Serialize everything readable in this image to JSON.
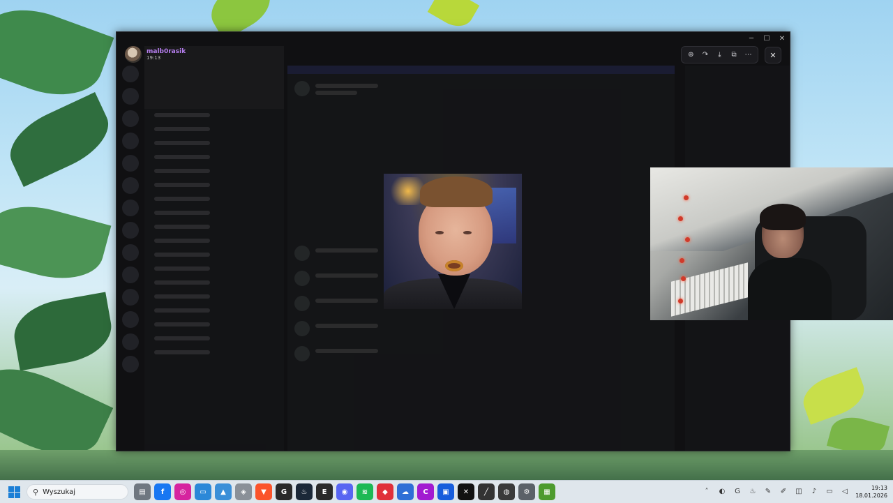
{
  "viewer": {
    "uploader_name": "malb0rasik",
    "upload_time": "19:13"
  },
  "taskbar": {
    "search_placeholder": "Wyszukaj",
    "time": "19:13",
    "date": "18.01.2026",
    "apps": [
      {
        "name": "file-explorer-icon",
        "glyph": "▤",
        "color": "#6f7780"
      },
      {
        "name": "facebook-icon",
        "glyph": "f",
        "color": "#1877f2"
      },
      {
        "name": "instagram-icon",
        "glyph": "◎",
        "color": "#d6249f"
      },
      {
        "name": "monitor-icon",
        "glyph": "▭",
        "color": "#2b88d8"
      },
      {
        "name": "photos-icon",
        "glyph": "▲",
        "color": "#3a8fd8"
      },
      {
        "name": "shield-icon",
        "glyph": "◈",
        "color": "#8a9098"
      },
      {
        "name": "brave-icon",
        "glyph": "▼",
        "color": "#fb542b"
      },
      {
        "name": "g-app-icon",
        "glyph": "G",
        "color": "#2a2a2a"
      },
      {
        "name": "steam-icon",
        "glyph": "♨",
        "color": "#1b2838"
      },
      {
        "name": "epic-games-icon",
        "glyph": "E",
        "color": "#2a2a2a"
      },
      {
        "name": "discord-icon",
        "glyph": "◉",
        "color": "#5865f2"
      },
      {
        "name": "spotify-icon",
        "glyph": "≋",
        "color": "#1db954"
      },
      {
        "name": "red-app-icon",
        "glyph": "◆",
        "color": "#e0303a"
      },
      {
        "name": "cloud-app-icon",
        "glyph": "☁",
        "color": "#2f6fd6"
      },
      {
        "name": "c-app-icon",
        "glyph": "C",
        "color": "#a21bd1"
      },
      {
        "name": "bitwarden-icon",
        "glyph": "▣",
        "color": "#175ddc"
      },
      {
        "name": "capcut-icon",
        "glyph": "✕",
        "color": "#111111"
      },
      {
        "name": "notepad-icon",
        "glyph": "╱",
        "color": "#333333"
      },
      {
        "name": "obs-icon",
        "glyph": "◍",
        "color": "#3a3a3a"
      },
      {
        "name": "settings-icon",
        "glyph": "⚙",
        "color": "#5b6168"
      },
      {
        "name": "minecraft-icon",
        "glyph": "▦",
        "color": "#4e9b2e"
      }
    ],
    "tray": [
      "chevron-up-icon",
      "game-controller-icon",
      "g-tray-icon",
      "steam-tray-icon",
      "color-picker-icon",
      "pen-icon",
      "network-icon",
      "mic-icon",
      "display-icon",
      "volume-icon"
    ]
  },
  "colors": {
    "uploader_name": "#b77ff0",
    "discord_accent": "#5865f2",
    "windows_accent": "#1c7fd6"
  }
}
